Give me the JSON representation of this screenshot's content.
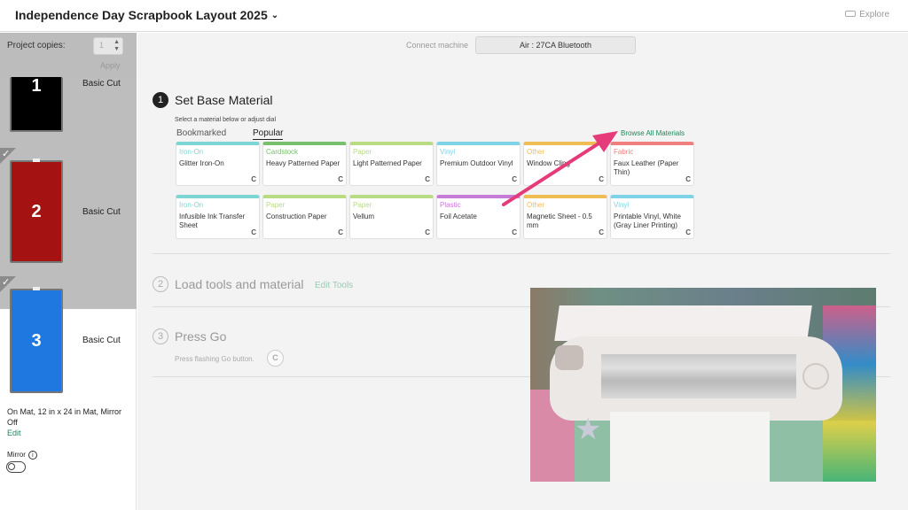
{
  "header": {
    "title": "Independence Day Scrapbook Layout 2025",
    "explore_label": "Explore"
  },
  "sidebar": {
    "copies_label": "Project copies:",
    "copies_value": "1",
    "apply_label": "Apply",
    "mats": [
      {
        "number": "1",
        "label": "Basic Cut",
        "color": "#000000"
      },
      {
        "number": "2",
        "label": "Basic Cut",
        "color": "#a51212"
      },
      {
        "number": "3",
        "label": "Basic Cut",
        "color": "#1e78e0"
      }
    ],
    "mat_info": "On Mat, 12 in x 24 in Mat, Mirror Off",
    "edit_label": "Edit",
    "mirror_label": "Mirror",
    "mirror_info_icon": "i",
    "mirror_on": false
  },
  "connect": {
    "label": "Connect machine",
    "button": "Air : 27CA Bluetooth"
  },
  "step1": {
    "number": "1",
    "title": "Set Base Material",
    "subtitle": "Select a material below or adjust dial",
    "tabs": [
      "Bookmarked",
      "Popular"
    ],
    "browse": "Browse All Materials",
    "cards": [
      {
        "category": "Iron-On",
        "name": "Glitter Iron-On",
        "color": "#7dd6d3"
      },
      {
        "category": "Cardstock",
        "name": "Heavy Patterned Paper",
        "color": "#78c06e"
      },
      {
        "category": "Paper",
        "name": "Light Patterned Paper",
        "color": "#b9dc82"
      },
      {
        "category": "Vinyl",
        "name": "Premium Outdoor Vinyl",
        "color": "#7fd3e6"
      },
      {
        "category": "Other",
        "name": "Window Cling",
        "color": "#f0bd55"
      },
      {
        "category": "Fabric",
        "name": "Faux Leather (Paper Thin)",
        "color": "#f08080"
      },
      {
        "category": "Iron-On",
        "name": "Infusible Ink Transfer Sheet",
        "color": "#7dd6d3"
      },
      {
        "category": "Paper",
        "name": "Construction Paper",
        "color": "#b9dc82"
      },
      {
        "category": "Paper",
        "name": "Vellum",
        "color": "#b9dc82"
      },
      {
        "category": "Plastic",
        "name": "Foil Acetate",
        "color": "#c77bd8"
      },
      {
        "category": "Other",
        "name": "Magnetic Sheet - 0.5 mm",
        "color": "#f0bd55"
      },
      {
        "category": "Vinyl",
        "name": "Printable Vinyl, White (Gray Liner Printing)",
        "color": "#7fd3e6"
      }
    ],
    "card_mark": "C"
  },
  "step2": {
    "number": "2",
    "title": "Load tools and material",
    "edit_tools": "Edit Tools"
  },
  "step3": {
    "number": "3",
    "title": "Press Go",
    "subtitle": "Press flashing Go button.",
    "go_mark": "C"
  },
  "colors": {
    "accent_green": "#1a8a5a",
    "arrow_pink": "#e53b7a"
  }
}
